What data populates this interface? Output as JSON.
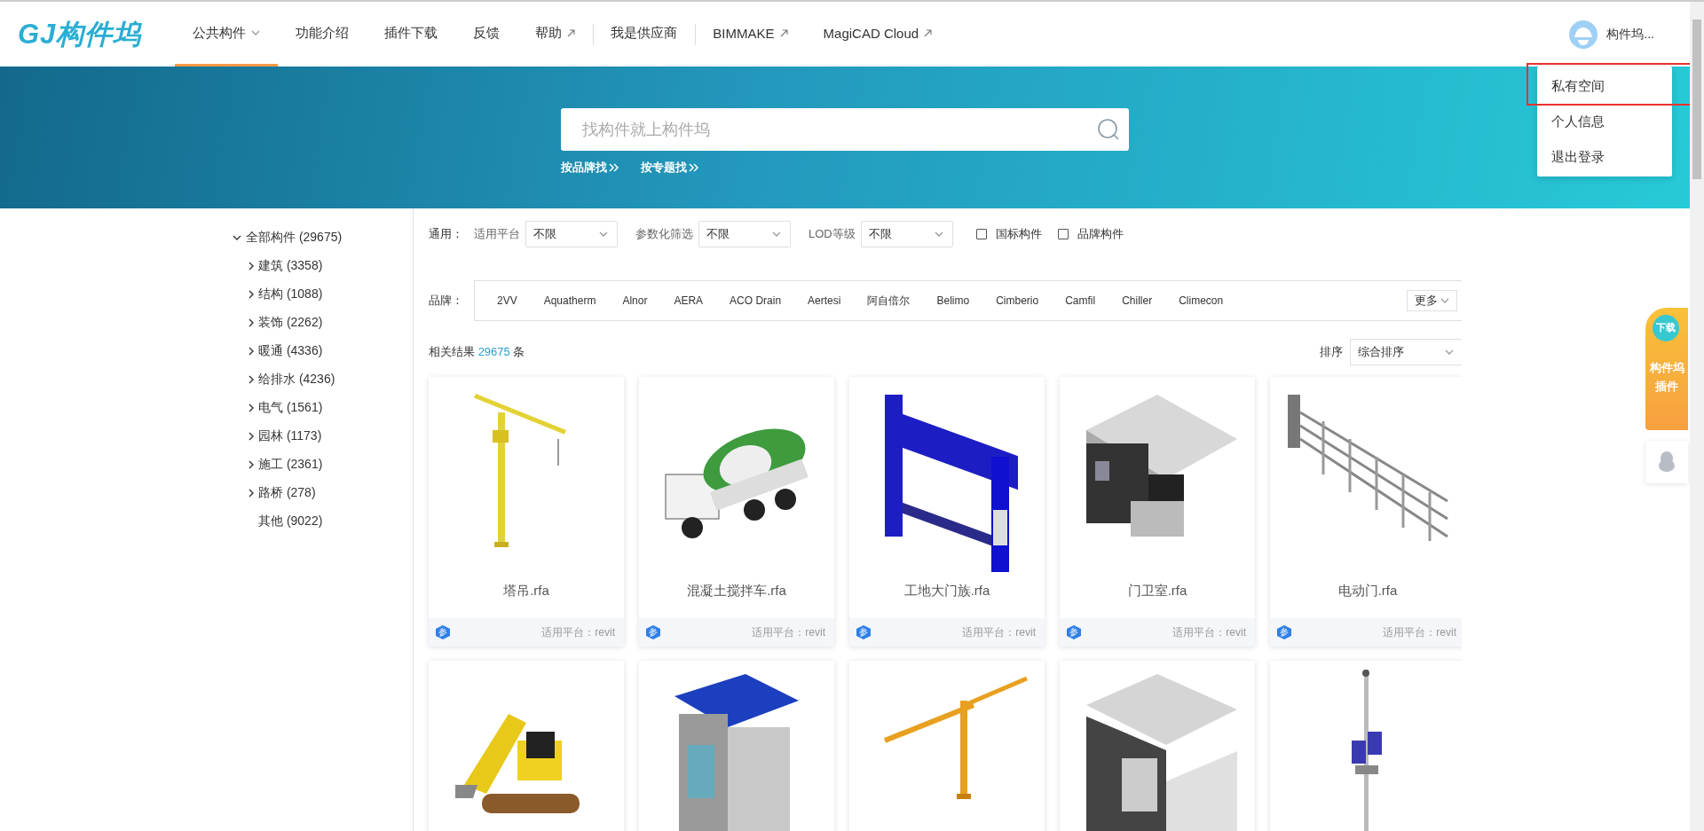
{
  "header": {
    "logo": "GJ构件坞",
    "nav": [
      {
        "label": "公共构件",
        "selected": true,
        "kind": "menu",
        "separated": false
      },
      {
        "label": "功能介绍",
        "selected": false,
        "kind": "plain",
        "separated": false
      },
      {
        "label": "插件下载",
        "selected": false,
        "kind": "plain",
        "separated": false
      },
      {
        "label": "反馈",
        "selected": false,
        "kind": "plain",
        "separated": false
      },
      {
        "label": "帮助",
        "selected": false,
        "kind": "external",
        "separated": false
      },
      {
        "label": "我是供应商",
        "selected": false,
        "kind": "plain",
        "separated": true
      },
      {
        "label": "BIMMAKE",
        "selected": false,
        "kind": "external",
        "separated": true
      },
      {
        "label": "MagiCAD Cloud",
        "selected": false,
        "kind": "external",
        "separated": false
      }
    ],
    "user": {
      "name": "构件坞..."
    }
  },
  "user_menu": {
    "items": [
      {
        "label": "私有空间",
        "highlighted": true
      },
      {
        "label": "个人信息",
        "highlighted": false
      },
      {
        "label": "退出登录",
        "highlighted": false
      }
    ]
  },
  "search": {
    "placeholder": "找构件就上构件坞",
    "links": [
      "按品牌找",
      "按专题找"
    ]
  },
  "tree": {
    "label": "全部构件 (29675)",
    "expanded": true,
    "children": [
      {
        "label": "建筑 (3358)",
        "kind": "branch",
        "expanded": false
      },
      {
        "label": "结构 (1088)",
        "kind": "branch",
        "expanded": false
      },
      {
        "label": "装饰 (2262)",
        "kind": "branch",
        "expanded": false
      },
      {
        "label": "暖通 (4336)",
        "kind": "branch",
        "expanded": false
      },
      {
        "label": "给排水 (4236)",
        "kind": "branch",
        "expanded": false
      },
      {
        "label": "电气 (1561)",
        "kind": "branch",
        "expanded": false
      },
      {
        "label": "园林 (1173)",
        "kind": "branch",
        "expanded": false
      },
      {
        "label": "施工 (2361)",
        "kind": "branch",
        "expanded": false
      },
      {
        "label": "路桥 (278)",
        "kind": "branch",
        "expanded": false
      },
      {
        "label": "其他 (9022)",
        "kind": "leaf",
        "expanded": false
      }
    ]
  },
  "filters": {
    "label": "通用：",
    "selects": [
      {
        "label": "适用平台",
        "value": "不限"
      },
      {
        "label": "参数化筛选",
        "value": "不限"
      },
      {
        "label": "LOD等级",
        "value": "不限"
      }
    ],
    "checkboxes": [
      {
        "label": "国标构件",
        "checked": false
      },
      {
        "label": "品牌构件",
        "checked": false
      }
    ]
  },
  "brands": {
    "label": "品牌：",
    "items": [
      "2VV",
      "Aquatherm",
      "Alnor",
      "AERA",
      "ACO Drain",
      "Aertesi",
      "阿自倍尔",
      "Belimo",
      "Cimberio",
      "Camfil",
      "Chiller",
      "Climecon"
    ],
    "more": "更多"
  },
  "results": {
    "prefix": "相关结果",
    "count": "29675",
    "suffix": "条",
    "sort_label": "排序",
    "sort_value": "综合排序"
  },
  "cards": [
    {
      "kind": "card",
      "name": "塔吊.rfa",
      "badge": "参",
      "platform": "适用平台：revit"
    },
    {
      "kind": "card",
      "name": "混凝土搅拌车.rfa",
      "badge": "参",
      "platform": "适用平台：revit"
    },
    {
      "kind": "card",
      "name": "工地大门族.rfa",
      "badge": "参",
      "platform": "适用平台：revit"
    },
    {
      "kind": "card",
      "name": "门卫室.rfa",
      "badge": "参",
      "platform": "适用平台：revit"
    },
    {
      "kind": "card",
      "name": "电动门.rfa",
      "badge": "参",
      "platform": "适用平台：revit"
    },
    {
      "kind": "picture"
    },
    {
      "kind": "picture"
    },
    {
      "kind": "picture"
    },
    {
      "kind": "picture"
    },
    {
      "kind": "picture"
    }
  ],
  "side_widgets": {
    "badge": "下载",
    "lines": [
      "构件坞",
      "插件"
    ]
  }
}
